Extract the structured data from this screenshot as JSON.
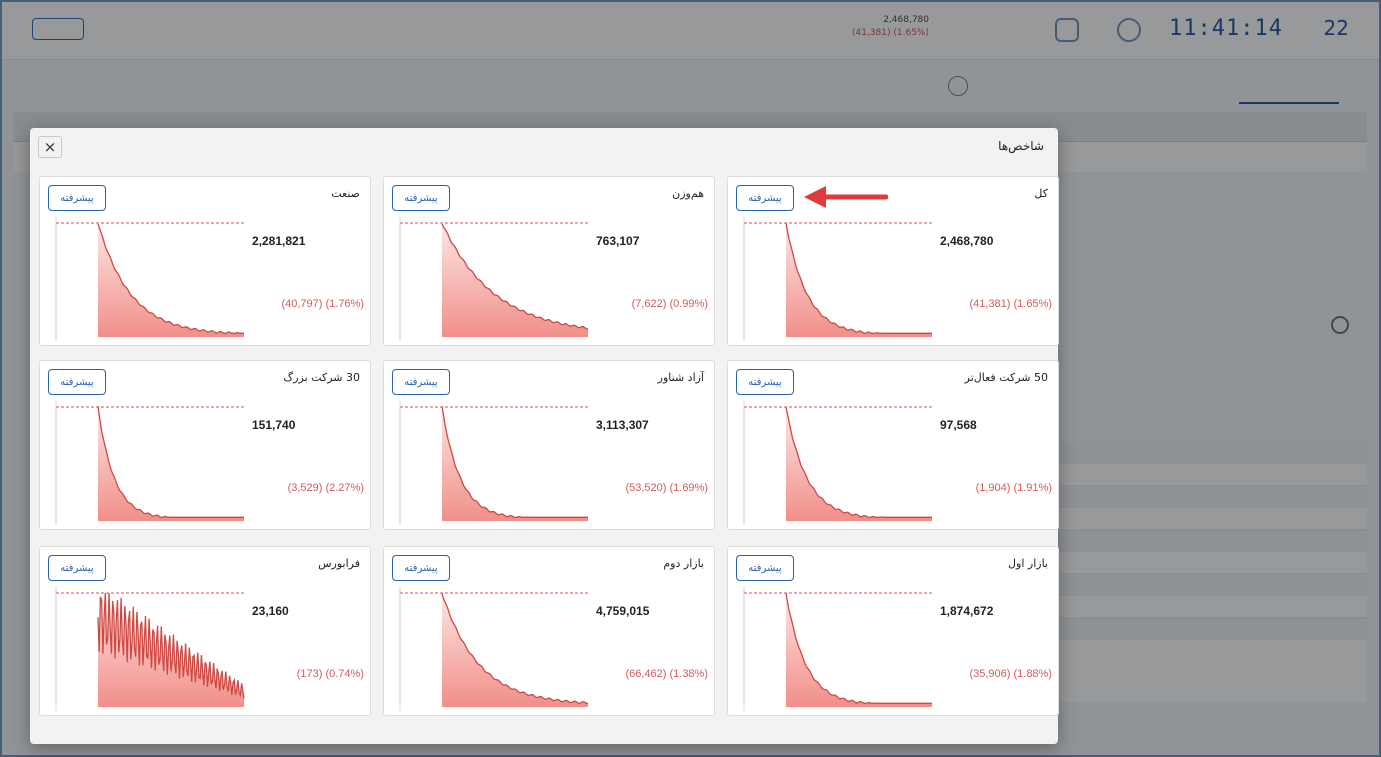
{
  "background": {
    "clock": "11:41:14",
    "date_day": "22",
    "top_index_value": "2,468,780",
    "top_index_change": "(41,381) (1.65%)"
  },
  "modal": {
    "title": "شاخص‌ها",
    "close_label": "×",
    "advanced_label": "پیشرفته",
    "cards": [
      {
        "title": "کل",
        "value": "2,468,780",
        "change": "(41,381) (1.65%)"
      },
      {
        "title": "هم‌وزن",
        "value": "763,107",
        "change": "(7,622) (0.99%)"
      },
      {
        "title": "صنعت",
        "value": "2,281,821",
        "change": "(40,797) (1.76%)"
      },
      {
        "title": "50 شرکت فعال‌تر",
        "value": "97,568",
        "change": "(1,904) (1.91%)"
      },
      {
        "title": "آزاد شناور",
        "value": "3,113,307",
        "change": "(53,520) (1.69%)"
      },
      {
        "title": "30 شرکت بزرگ",
        "value": "151,740",
        "change": "(3,529) (2.27%)"
      },
      {
        "title": "بازار اول",
        "value": "1,874,672",
        "change": "(35,906) (1.88%)"
      },
      {
        "title": "بازار دوم",
        "value": "4,759,015",
        "change": "(66,462) (1.38%)"
      },
      {
        "title": "فرابورس",
        "value": "23,160",
        "change": "(173) (0.74%)"
      }
    ]
  },
  "colors": {
    "accent_blue": "#2b62a8",
    "negative_red": "#d45b5b",
    "chart_line": "#cc4a43",
    "chart_fill_top": "#fde6e4",
    "chart_fill_bottom": "#f18f89"
  },
  "icons": {
    "close": "close-icon",
    "arrow": "red-arrow-icon"
  }
}
